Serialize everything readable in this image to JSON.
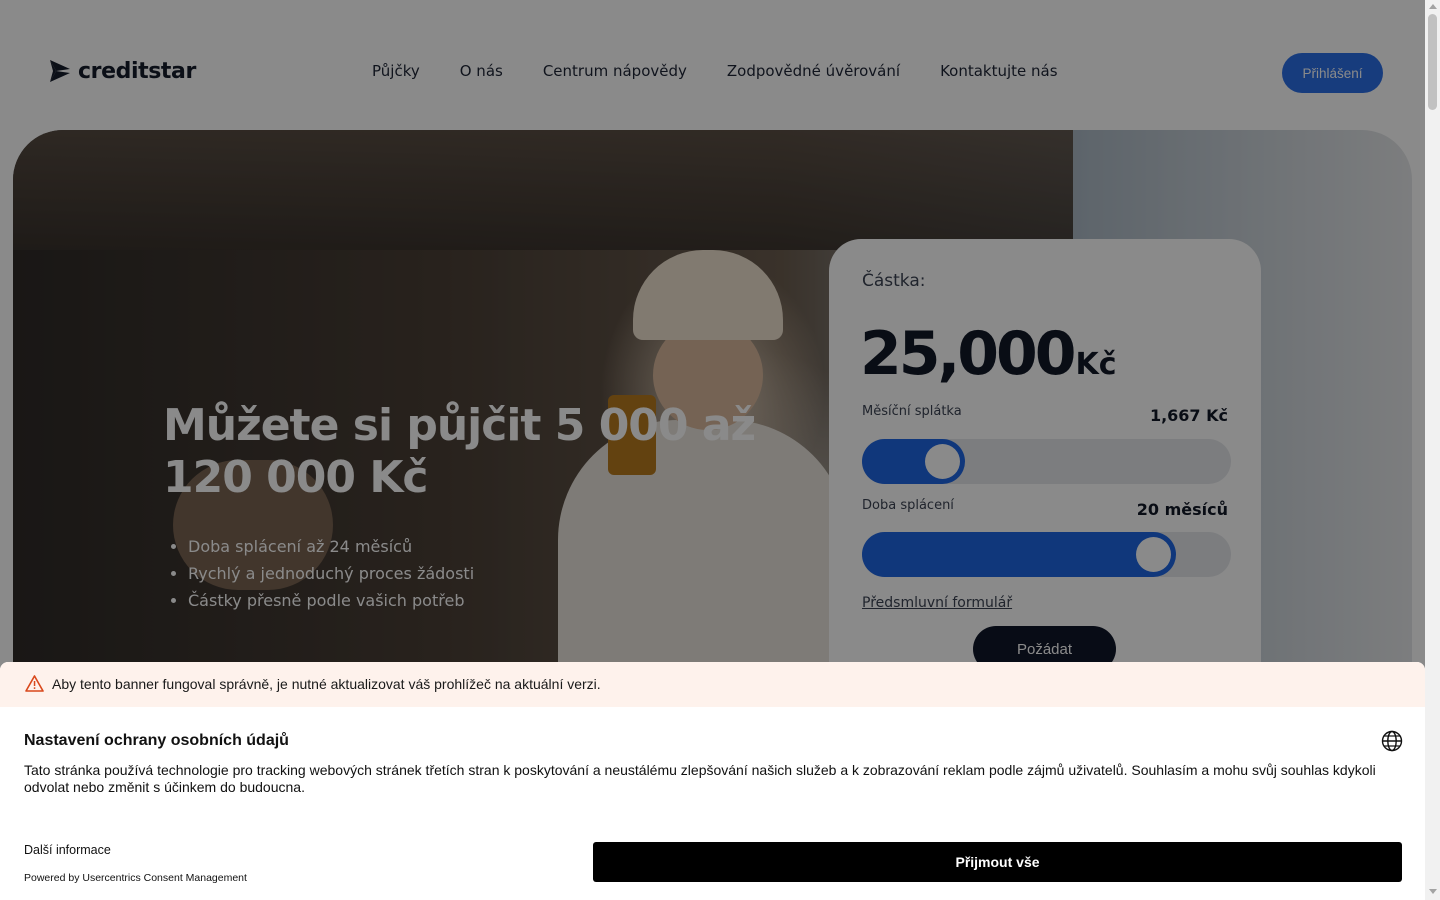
{
  "header": {
    "logo_text": "creditstar",
    "nav": [
      "Půjčky",
      "O nás",
      "Centrum nápovědy",
      "Zodpovědné úvěrování",
      "Kontaktujte nás"
    ],
    "login_label": "Přihlášení"
  },
  "hero": {
    "title": "Můžete si půjčit 5 000 až 120 000 Kč",
    "bullets": [
      "Doba splácení až 24 měsíců",
      "Rychlý a jednoduchý proces žádosti",
      "Částky přesně podle vašich potřeb"
    ]
  },
  "calculator": {
    "amount_label": "Částka:",
    "amount_value": "25,000",
    "amount_currency": "Kč",
    "monthly_label": "Měsíční splátka",
    "monthly_value": "1,667 Kč",
    "monthly_slider_fraction": 0.18,
    "duration_label": "Doba splácení",
    "duration_value": "20 měsíců",
    "duration_slider_fraction": 0.83,
    "pre_form_link": "Předsmluvní formulář",
    "request_label": "Požádat",
    "accent_color": "#1e66e4"
  },
  "consent": {
    "warning_text": "Aby tento banner fungoval správně, je nutné aktualizovat váš prohlížeč na aktuální verzi.",
    "title": "Nastavení ochrany osobních údajů",
    "body": "Tato stránka používá technologie pro tracking webových stránek třetích stran k poskytování a neustálému zlepšování našich služeb a k zobrazování reklam podle zájmů uživatelů. Souhlasím a mohu svůj souhlas kdykoli odvolat nebo změnit s účinkem do budoucna.",
    "more_info": "Další informace",
    "powered_by": "Powered by Usercentrics Consent Management",
    "accept_label": "Přijmout vše",
    "warning_icon": "warning-triangle-icon",
    "language_icon": "globe-icon"
  }
}
